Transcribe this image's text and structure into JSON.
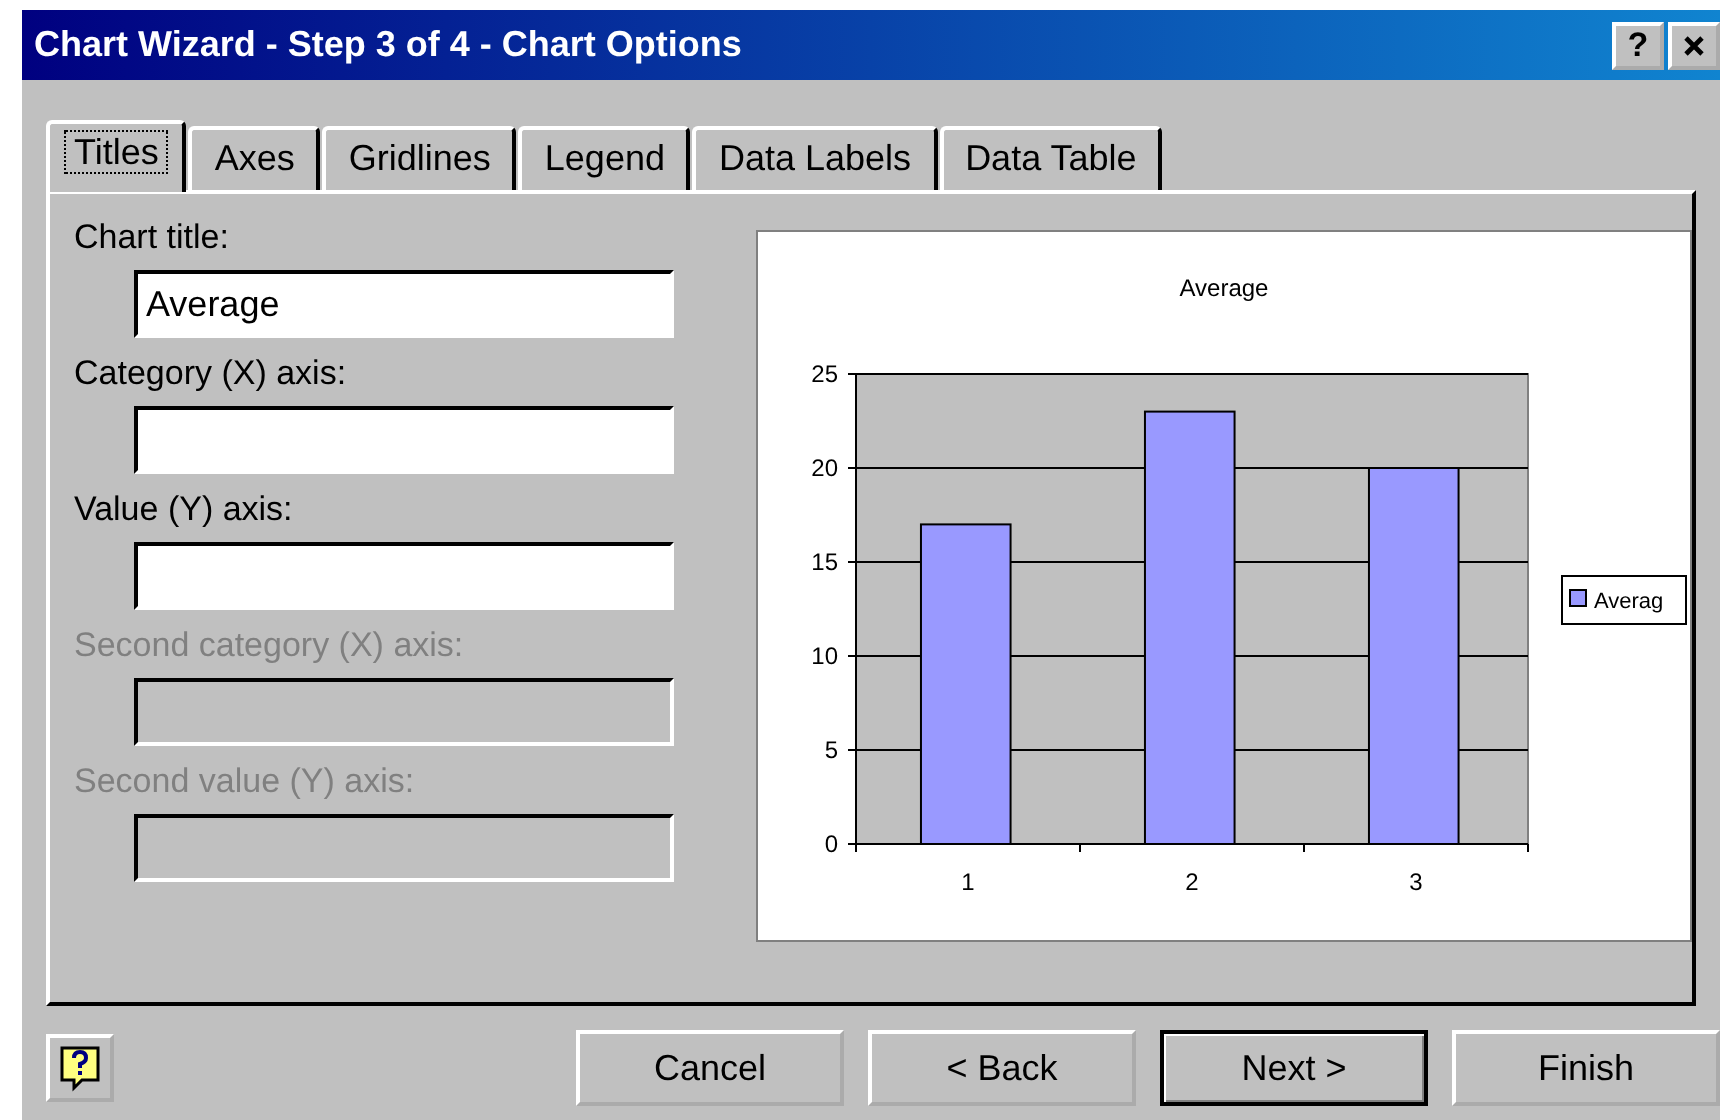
{
  "window": {
    "title": "Chart Wizard - Step 3 of 4 - Chart Options",
    "help_glyph": "?"
  },
  "tabs": [
    {
      "label": "Titles",
      "selected": true
    },
    {
      "label": "Axes",
      "selected": false
    },
    {
      "label": "Gridlines",
      "selected": false
    },
    {
      "label": "Legend",
      "selected": false
    },
    {
      "label": "Data Labels",
      "selected": false
    },
    {
      "label": "Data Table",
      "selected": false
    }
  ],
  "fields": [
    {
      "label": "Chart title:",
      "value": "Average",
      "disabled": false
    },
    {
      "label": "Category (X) axis:",
      "disabled": false
    },
    {
      "label": "Value (Y) axis:",
      "disabled": false
    },
    {
      "label": "Second category (X) axis:",
      "disabled": true
    },
    {
      "label": "Second value (Y) axis:",
      "disabled": true
    }
  ],
  "preview": {
    "chart_data": {
      "type": "bar",
      "title": "Average",
      "categories": [
        "1",
        "2",
        "3"
      ],
      "grid": true,
      "series": [
        {
          "name": "Averag",
          "color": "#9999ff",
          "values": [
            17,
            23,
            20
          ]
        }
      ],
      "ylim": [
        0,
        25
      ],
      "yticks": [
        0,
        5,
        10,
        15,
        20,
        25
      ]
    }
  },
  "buttons": [
    {
      "label": "Cancel",
      "default": false
    },
    {
      "label": "< Back",
      "default": false
    },
    {
      "label": "Next >",
      "default": true
    },
    {
      "label": "Finish",
      "default": false
    }
  ]
}
